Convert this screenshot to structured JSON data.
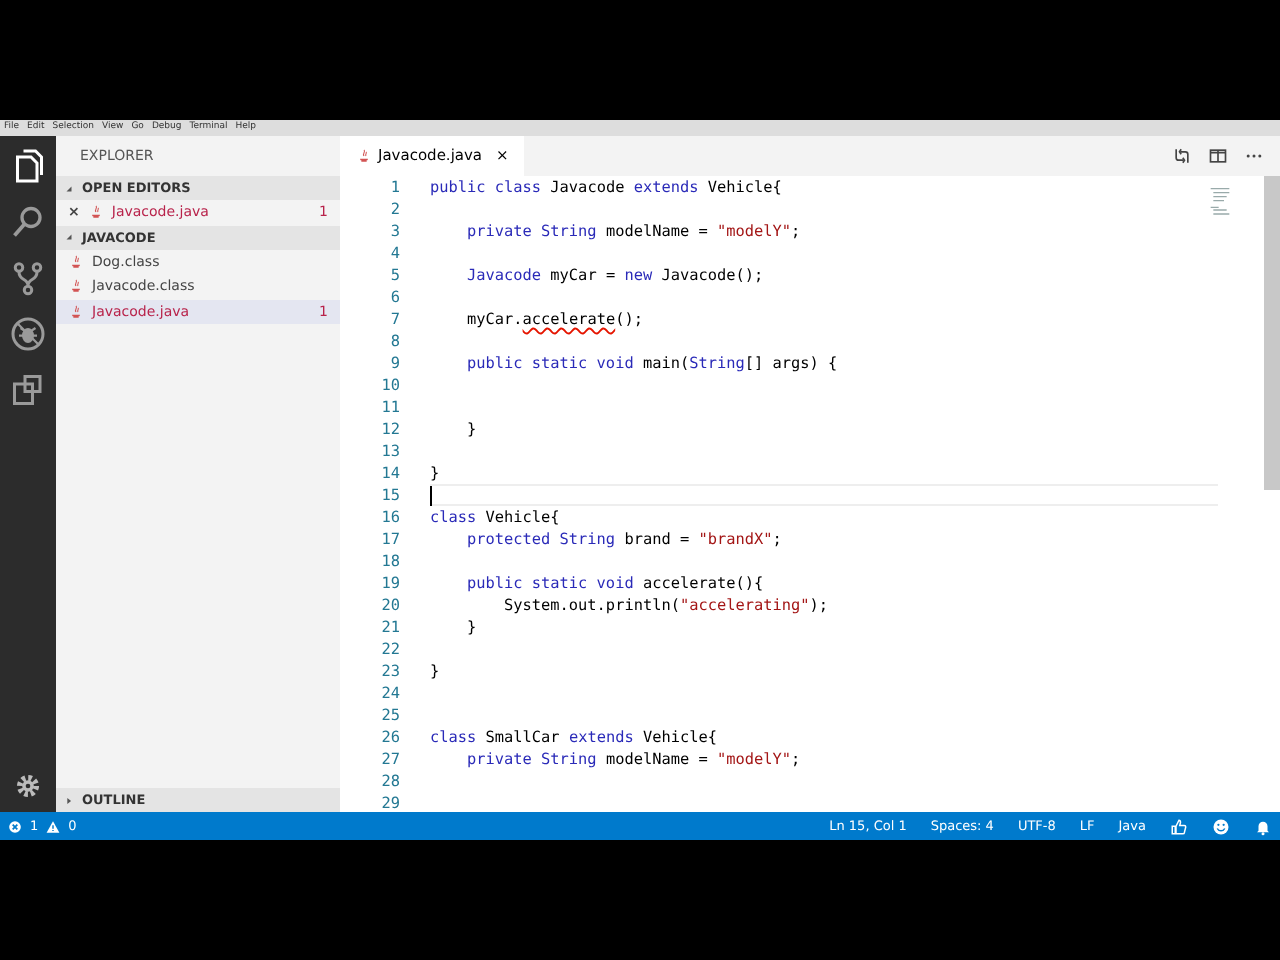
{
  "menu": [
    "File",
    "Edit",
    "Selection",
    "View",
    "Go",
    "Debug",
    "Terminal",
    "Help"
  ],
  "activity_bar": [
    {
      "kind": "files",
      "selected": true
    },
    {
      "kind": "search",
      "selected": false
    },
    {
      "kind": "source-control",
      "selected": false
    },
    {
      "kind": "debug",
      "selected": false
    },
    {
      "kind": "extensions",
      "selected": false
    }
  ],
  "sidebar": {
    "title": "EXPLORER",
    "sections": [
      {
        "title": "OPEN EDITORS",
        "expanded": true,
        "items": [
          {
            "name": "Javacode.java",
            "error": true,
            "count": "1",
            "close": "×",
            "selected": false
          }
        ]
      },
      {
        "title": "JAVACODE",
        "expanded": true,
        "items": [
          {
            "name": "Dog.class",
            "error": false,
            "selected": false
          },
          {
            "name": "Javacode.class",
            "error": false,
            "selected": false
          },
          {
            "name": "Javacode.java",
            "error": true,
            "count": "1",
            "selected": true
          }
        ]
      },
      {
        "title": "OUTLINE",
        "expanded": false
      }
    ]
  },
  "tabs": [
    {
      "label": "Javacode.java",
      "close": "×",
      "selected": true
    }
  ],
  "editor": {
    "lines": [
      {
        "number": "1",
        "current": false,
        "tokens": [
          {
            "kind": "keyword",
            "text": "public class"
          },
          {
            "kind": "plain",
            "text": " Javacode "
          },
          {
            "kind": "keyword",
            "text": "extends"
          },
          {
            "kind": "plain",
            "text": " Vehicle{"
          }
        ]
      },
      {
        "number": "2",
        "current": false
      },
      {
        "number": "3",
        "current": false,
        "tokens": [
          {
            "kind": "keyword",
            "text": "    private String"
          },
          {
            "kind": "plain",
            "text": " modelName = "
          },
          {
            "kind": "string",
            "text": "\"modelY\""
          },
          {
            "kind": "plain",
            "text": ";"
          }
        ]
      },
      {
        "number": "4",
        "current": false
      },
      {
        "number": "5",
        "current": false,
        "tokens": [
          {
            "kind": "keyword",
            "text": "    Javacode"
          },
          {
            "kind": "plain",
            "text": " myCar = "
          },
          {
            "kind": "keyword",
            "text": "new"
          },
          {
            "kind": "plain",
            "text": " Javacode();"
          }
        ]
      },
      {
        "number": "6",
        "current": false
      },
      {
        "number": "7",
        "current": false,
        "tokens": [
          {
            "kind": "plain",
            "text": "    myCar."
          },
          {
            "kind": "error",
            "text": "accelerate"
          },
          {
            "kind": "plain",
            "text": "();"
          }
        ]
      },
      {
        "number": "8",
        "current": false
      },
      {
        "number": "9",
        "current": false,
        "tokens": [
          {
            "kind": "keyword",
            "text": "    public static void"
          },
          {
            "kind": "plain",
            "text": " main("
          },
          {
            "kind": "keyword",
            "text": "String"
          },
          {
            "kind": "plain",
            "text": "[] args) {"
          }
        ]
      },
      {
        "number": "10",
        "current": false
      },
      {
        "number": "11",
        "current": false
      },
      {
        "number": "12",
        "current": false,
        "tokens": [
          {
            "kind": "plain",
            "text": "    }"
          }
        ]
      },
      {
        "number": "13",
        "current": false
      },
      {
        "number": "14",
        "current": false,
        "tokens": [
          {
            "kind": "plain",
            "text": "}"
          }
        ]
      },
      {
        "number": "15",
        "current": true
      },
      {
        "number": "16",
        "current": false,
        "tokens": [
          {
            "kind": "keyword",
            "text": "class"
          },
          {
            "kind": "plain",
            "text": " Vehicle{"
          }
        ]
      },
      {
        "number": "17",
        "current": false,
        "tokens": [
          {
            "kind": "keyword",
            "text": "    protected String"
          },
          {
            "kind": "plain",
            "text": " brand = "
          },
          {
            "kind": "string",
            "text": "\"brandX\""
          },
          {
            "kind": "plain",
            "text": ";"
          }
        ]
      },
      {
        "number": "18",
        "current": false
      },
      {
        "number": "19",
        "current": false,
        "tokens": [
          {
            "kind": "keyword",
            "text": "    public static void"
          },
          {
            "kind": "plain",
            "text": " accelerate(){"
          }
        ]
      },
      {
        "number": "20",
        "current": false,
        "tokens": [
          {
            "kind": "plain",
            "text": "        System.out.println("
          },
          {
            "kind": "string",
            "text": "\"accelerating\""
          },
          {
            "kind": "plain",
            "text": ");"
          }
        ]
      },
      {
        "number": "21",
        "current": false,
        "tokens": [
          {
            "kind": "plain",
            "text": "    }"
          }
        ]
      },
      {
        "number": "22",
        "current": false
      },
      {
        "number": "23",
        "current": false,
        "tokens": [
          {
            "kind": "plain",
            "text": "}"
          }
        ]
      },
      {
        "number": "24",
        "current": false
      },
      {
        "number": "25",
        "current": false
      },
      {
        "number": "26",
        "current": false,
        "tokens": [
          {
            "kind": "keyword",
            "text": "class"
          },
          {
            "kind": "plain",
            "text": " SmallCar "
          },
          {
            "kind": "keyword",
            "text": "extends"
          },
          {
            "kind": "plain",
            "text": " Vehicle{"
          }
        ]
      },
      {
        "number": "27",
        "current": false,
        "tokens": [
          {
            "kind": "keyword",
            "text": "    private String"
          },
          {
            "kind": "plain",
            "text": " modelName = "
          },
          {
            "kind": "string",
            "text": "\"modelY\""
          },
          {
            "kind": "plain",
            "text": ";"
          }
        ]
      },
      {
        "number": "28",
        "current": false
      },
      {
        "number": "29",
        "current": false
      }
    ]
  },
  "status_bar": {
    "errors": "1",
    "warnings": "0",
    "items": [
      "Ln 15, Col 1",
      "Spaces: 4",
      "UTF-8",
      "LF",
      "Java"
    ]
  }
}
